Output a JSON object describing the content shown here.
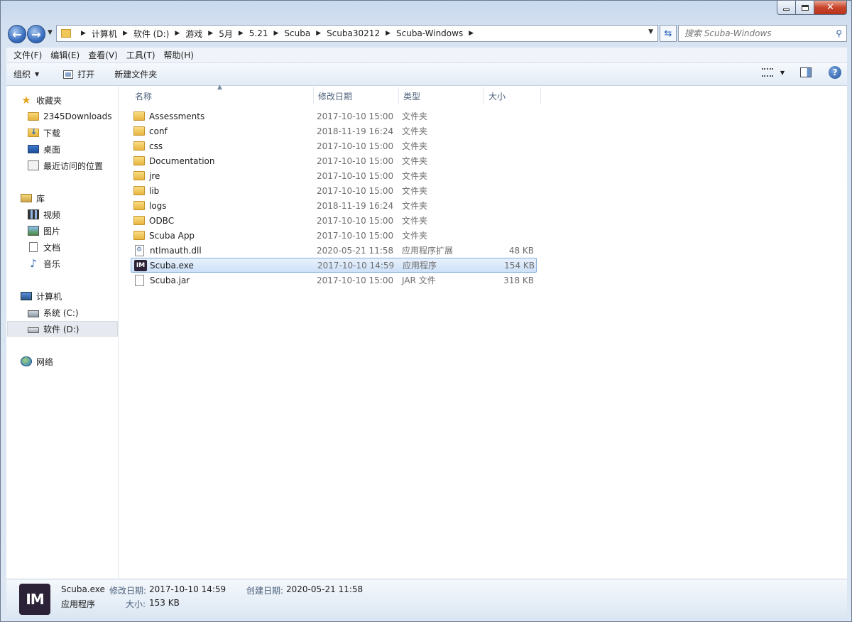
{
  "address": {
    "crumbs": [
      "计算机",
      "软件 (D:)",
      "游戏",
      "5月",
      "5.21",
      "Scuba",
      "Scuba30212",
      "Scuba-Windows"
    ]
  },
  "search": {
    "placeholder": "搜索 Scuba-Windows"
  },
  "menu": [
    "文件(F)",
    "编辑(E)",
    "查看(V)",
    "工具(T)",
    "帮助(H)"
  ],
  "toolbar": {
    "organize": "组织",
    "open": "打开",
    "new_folder": "新建文件夹"
  },
  "nav": {
    "favorites": "收藏夹",
    "fav_items": [
      "2345Downloads",
      "下载",
      "桌面",
      "最近访问的位置"
    ],
    "libraries": "库",
    "lib_items": [
      "视频",
      "图片",
      "文档",
      "音乐"
    ],
    "computer": "计算机",
    "drives": [
      "系统 (C:)",
      "软件 (D:)"
    ],
    "network": "网络"
  },
  "columns": {
    "name": "名称",
    "date": "修改日期",
    "type": "类型",
    "size": "大小"
  },
  "files": [
    {
      "name": "Assessments",
      "date": "2017-10-10 15:00",
      "type": "文件夹",
      "size": "",
      "kind": "folder"
    },
    {
      "name": "conf",
      "date": "2018-11-19 16:24",
      "type": "文件夹",
      "size": "",
      "kind": "folder"
    },
    {
      "name": "css",
      "date": "2017-10-10 15:00",
      "type": "文件夹",
      "size": "",
      "kind": "folder"
    },
    {
      "name": "Documentation",
      "date": "2017-10-10 15:00",
      "type": "文件夹",
      "size": "",
      "kind": "folder"
    },
    {
      "name": "jre",
      "date": "2017-10-10 15:00",
      "type": "文件夹",
      "size": "",
      "kind": "folder"
    },
    {
      "name": "lib",
      "date": "2017-10-10 15:00",
      "type": "文件夹",
      "size": "",
      "kind": "folder"
    },
    {
      "name": "logs",
      "date": "2018-11-19 16:24",
      "type": "文件夹",
      "size": "",
      "kind": "folder"
    },
    {
      "name": "ODBC",
      "date": "2017-10-10 15:00",
      "type": "文件夹",
      "size": "",
      "kind": "folder"
    },
    {
      "name": "Scuba App",
      "date": "2017-10-10 15:00",
      "type": "文件夹",
      "size": "",
      "kind": "folder"
    },
    {
      "name": "ntlmauth.dll",
      "date": "2020-05-21 11:58",
      "type": "应用程序扩展",
      "size": "48 KB",
      "kind": "dll"
    },
    {
      "name": "Scuba.exe",
      "date": "2017-10-10 14:59",
      "type": "应用程序",
      "size": "154 KB",
      "kind": "exe",
      "selected": true
    },
    {
      "name": "Scuba.jar",
      "date": "2017-10-10 15:00",
      "type": "JAR 文件",
      "size": "318 KB",
      "kind": "jar"
    }
  ],
  "exe_icon_text": "IM",
  "details": {
    "name": "Scuba.exe",
    "type": "应用程序",
    "modified_label": "修改日期:",
    "modified": "2017-10-10 14:59",
    "created_label": "创建日期:",
    "created": "2020-05-21 11:58",
    "size_label": "大小:",
    "size": "153 KB"
  }
}
